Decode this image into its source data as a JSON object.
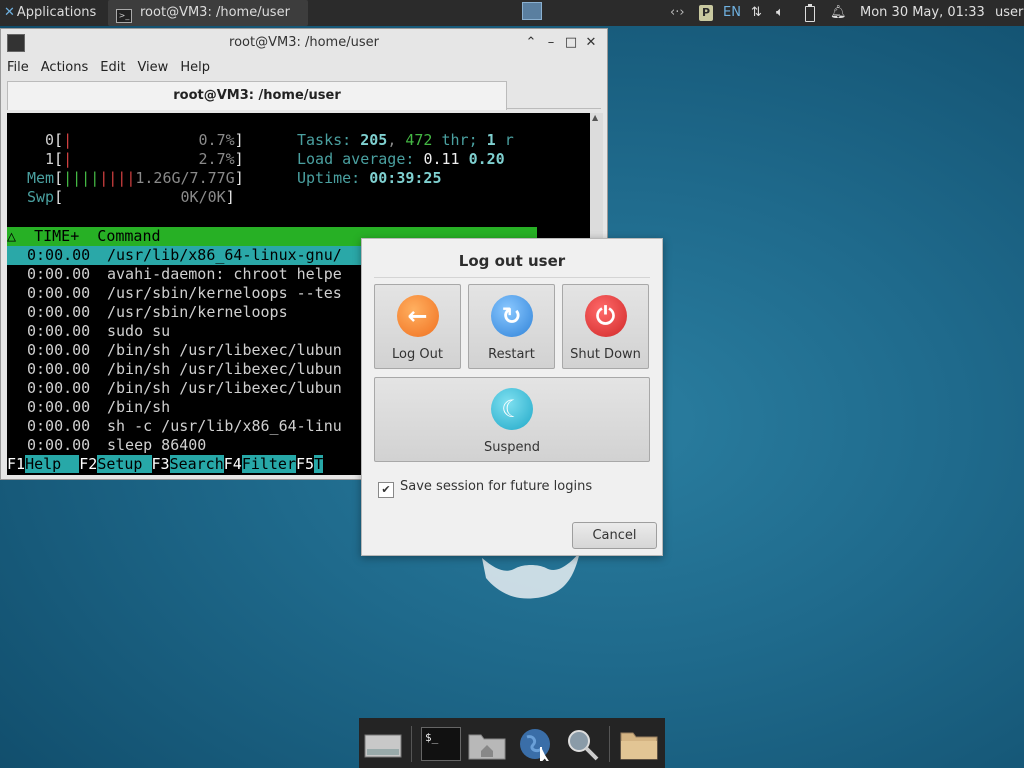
{
  "panel": {
    "apps_label": "Applications",
    "task_label": "root@VM3: /home/user",
    "tray_lang": "EN",
    "clock": "Mon 30 May, 01:33",
    "username": "user"
  },
  "terminal": {
    "title": "root@VM3: /home/user",
    "menu": [
      "File",
      "Actions",
      "Edit",
      "View",
      "Help"
    ],
    "tab_label": "root@VM3: /home/user",
    "cpu0_num": "0",
    "cpu0_pct": "0.7%",
    "cpu1_num": "1",
    "cpu1_pct": "2.7%",
    "mem_label": "Mem",
    "mem_value": "1.26G/7.77G",
    "swp_label": "Swp",
    "swp_value": "0K/0K",
    "tasks_label": "Tasks:",
    "tasks_count": "205",
    "threads": "472",
    "thr_label": "thr;",
    "running": "1",
    "running_label": "r",
    "load_label": "Load average:",
    "load_1": "0.11",
    "load_5": "0.20",
    "uptime_label": "Uptime:",
    "uptime": "00:39:25",
    "col_header": "△  TIME+  Command",
    "processes": [
      {
        "time": "0:00.00",
        "cmd": "/usr/lib/x86_64-linux-gnu/"
      },
      {
        "time": "0:00.00",
        "cmd": "avahi-daemon: chroot helpe"
      },
      {
        "time": "0:00.00",
        "cmd": "/usr/sbin/kerneloops --tes"
      },
      {
        "time": "0:00.00",
        "cmd": "/usr/sbin/kerneloops"
      },
      {
        "time": "0:00.00",
        "cmd": "sudo su"
      },
      {
        "time": "0:00.00",
        "cmd": "/bin/sh /usr/libexec/lubun"
      },
      {
        "time": "0:00.00",
        "cmd": "/bin/sh /usr/libexec/lubun"
      },
      {
        "time": "0:00.00",
        "cmd": "/bin/sh /usr/libexec/lubun"
      },
      {
        "time": "0:00.00",
        "cmd": "/bin/sh"
      },
      {
        "time": "0:00.00",
        "cmd": "sh -c /usr/lib/x86_64-linu"
      },
      {
        "time": "0:00.00",
        "cmd": "sleep 86400"
      }
    ],
    "fkeys": [
      {
        "key": "F1",
        "label": "Help  "
      },
      {
        "key": "F2",
        "label": "Setup "
      },
      {
        "key": "F3",
        "label": "Search"
      },
      {
        "key": "F4",
        "label": "Filter"
      },
      {
        "key": "F5",
        "label": "T"
      }
    ]
  },
  "dialog": {
    "title": "Log out user",
    "logout_label": "Log Out",
    "restart_label": "Restart",
    "shutdown_label": "Shut Down",
    "suspend_label": "Suspend",
    "save_session_label": "Save session for future logins",
    "save_session_checked": true,
    "cancel_label": "Cancel"
  },
  "dock": {
    "terminal_text": "$_"
  },
  "colors": {
    "desktop": "#1f6a8c",
    "panel": "#2b2b2b",
    "htop_green": "#27b025",
    "htop_cyan": "#2aa8a8"
  }
}
